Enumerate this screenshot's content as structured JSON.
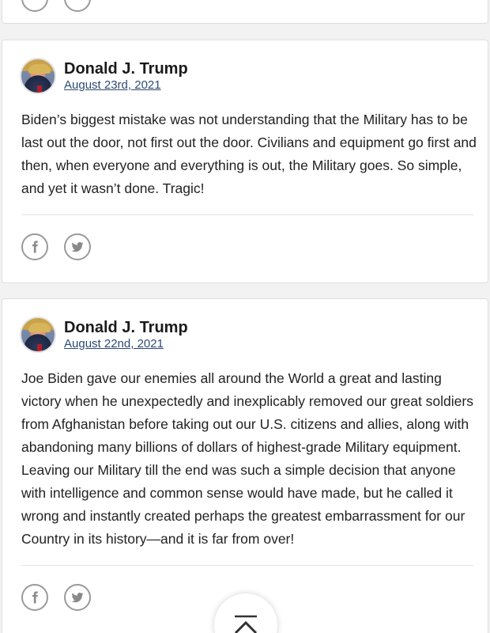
{
  "posts": [
    {
      "author": "Donald J. Trump",
      "date": "August 23rd, 2021",
      "text": "Biden’s biggest mistake was not understanding that the Military has to be last out the door, not first out the door. Civilians and equipment go first and then, when everyone and everything is out, the Military goes. So simple, and yet it wasn’t done. Tragic!"
    },
    {
      "author": "Donald J. Trump",
      "date": "August 22nd, 2021",
      "text": "Joe Biden gave our enemies all around the World a great and lasting victory when he unexpectedly and inexplicably removed our great soldiers from Afghanistan before taking out our U.S. citizens and allies, along with abandoning many billions of dollars of highest-grade Military equipment. Leaving our Military till the end was such a simple decision that anyone with intelligence and common sense would have made, but he called it wrong and instantly created perhaps the greatest embarrassment for our Country in its history—and it is far from over!"
    }
  ],
  "share_icons": [
    "facebook-icon",
    "twitter-icon"
  ],
  "scroll_top_icon": "chevron-up-icon",
  "colors": {
    "background": "#f2f2f2",
    "card": "#ffffff",
    "link": "#2d4a72",
    "icon": "#8a8a8a"
  }
}
